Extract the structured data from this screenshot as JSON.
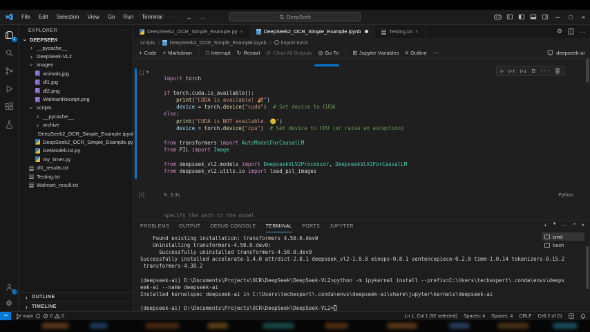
{
  "titlebar": {
    "menus": [
      "File",
      "Edit",
      "Selection",
      "View",
      "Go",
      "Run",
      "Terminal"
    ],
    "overflow": "···",
    "command_center": "DeepSeek",
    "icons": [
      "copilot-icon",
      "customize-layout-icon",
      "toggle-sidebar-icon",
      "toggle-panel-icon",
      "toggle-secondary-sidebar-icon",
      "minimize-icon",
      "maximize-icon",
      "close-icon"
    ]
  },
  "activitybar": {
    "icons": [
      "explorer-icon",
      "search-icon",
      "source-control-icon",
      "run-debug-icon",
      "extensions-icon",
      "testing-icon"
    ],
    "explorer_badge": "1",
    "account_badge": "1",
    "bottom_icons": [
      "account-icon",
      "settings-gear-icon"
    ]
  },
  "explorer": {
    "title": "EXPLORER",
    "root": "DEEPSEEK",
    "items": [
      {
        "label": "__pycache__",
        "type": "folder-collapsed",
        "level": 1
      },
      {
        "label": "DeepSeek-VL2",
        "type": "folder-collapsed",
        "level": 1
      },
      {
        "label": "images",
        "type": "folder-open",
        "level": 1
      },
      {
        "label": "animals.jpg",
        "type": "image",
        "level": 2
      },
      {
        "label": "dl1.jpg",
        "type": "image",
        "level": 2
      },
      {
        "label": "dl2.png",
        "type": "image",
        "level": 2
      },
      {
        "label": "WalmartReceipt.png",
        "type": "image",
        "level": 2
      },
      {
        "label": "scripts",
        "type": "folder-open",
        "level": 1
      },
      {
        "label": "__pycache__",
        "type": "folder-collapsed",
        "level": 2
      },
      {
        "label": "archive",
        "type": "folder-collapsed",
        "level": 2
      },
      {
        "label": "DeepSeek2_OCR_Simple_Example.ipynb",
        "type": "notebook",
        "level": 2
      },
      {
        "label": "DeepSeek2_OCR_Simple_Example.py",
        "type": "python",
        "level": 2
      },
      {
        "label": "GetModelList.py",
        "type": "python",
        "level": 2
      },
      {
        "label": "my_timer.py",
        "type": "python",
        "level": 2
      },
      {
        "label": "dl1_results.txt",
        "type": "text",
        "level": 1
      },
      {
        "label": "Testing.txt",
        "type": "text",
        "level": 1
      },
      {
        "label": "Walmart_result.txt",
        "type": "text",
        "level": 1
      }
    ],
    "sections": [
      "OUTLINE",
      "TIMELINE"
    ]
  },
  "editor": {
    "tabs": [
      {
        "label": "DeepSeek2_OCR_Simple_Example.py",
        "icon": "python",
        "active": false,
        "modified": false
      },
      {
        "label": "DeepSeek2_OCR_Simple_Example.ipynb",
        "icon": "notebook",
        "active": true,
        "modified": true
      },
      {
        "label": "Testing.txt",
        "icon": "text",
        "active": false,
        "modified": false
      }
    ],
    "breadcrumb": [
      {
        "label": "scripts"
      },
      {
        "label": "DeepSeek2_OCR_Simple_Example.ipynb",
        "icon": "notebook"
      },
      {
        "label": "import torch",
        "icon": "symbol"
      }
    ],
    "next_cell_preview": "specify the path to the model"
  },
  "notebook_toolbar": {
    "items": [
      {
        "icon": "add-icon",
        "label": "Code"
      },
      {
        "icon": "add-icon",
        "label": "Markdown"
      },
      {
        "sep": true
      },
      {
        "icon": "interrupt-icon",
        "label": "Interrupt"
      },
      {
        "icon": "restart-icon",
        "label": "Restart"
      },
      {
        "icon": "clear-outputs-icon",
        "label": "Clear All Outputs",
        "disabled": true
      },
      {
        "icon": "goto-icon",
        "label": "Go To"
      },
      {
        "sep": true
      },
      {
        "icon": "variables-icon",
        "label": "Jupyter Variables"
      },
      {
        "icon": "outline-icon",
        "label": "Outline"
      },
      {
        "icon": "more-icon",
        "label": "···"
      }
    ],
    "kernel": "deepseek-ai"
  },
  "cell": {
    "execution_count": "[1]",
    "duration": "5.3s",
    "language": "Python",
    "toolbar_icons": [
      "run-by-line-icon",
      "execute-above-icon",
      "execute-below-icon",
      "split-cell-icon",
      "more-actions-icon",
      "delete-cell-icon"
    ],
    "lines": [
      [
        [
          "kw",
          "import"
        ],
        [
          "tx",
          " torch"
        ]
      ],
      [],
      [
        [
          "kw",
          "if"
        ],
        [
          "tx",
          " torch.cuda.is_available():"
        ]
      ],
      [
        [
          "tx",
          "    "
        ],
        [
          "fn",
          "print"
        ],
        [
          "tx",
          "("
        ],
        [
          "st",
          "\"CUDA is available! 🎉\""
        ],
        [
          "tx",
          ")"
        ]
      ],
      [
        [
          "tx",
          "    "
        ],
        [
          "vr",
          "device"
        ],
        [
          "tx",
          " = torch."
        ],
        [
          "fn",
          "device"
        ],
        [
          "tx",
          "("
        ],
        [
          "st",
          "\"cuda\""
        ],
        [
          "tx",
          ")  "
        ],
        [
          "cm",
          "# Set device to CUDA"
        ]
      ],
      [
        [
          "kw",
          "else"
        ],
        [
          "tx",
          ":"
        ]
      ],
      [
        [
          "tx",
          "    "
        ],
        [
          "fn",
          "print"
        ],
        [
          "tx",
          "("
        ],
        [
          "st",
          "\"CUDA is NOT available. 😢\""
        ],
        [
          "tx",
          ")"
        ]
      ],
      [
        [
          "tx",
          "    "
        ],
        [
          "vr",
          "device"
        ],
        [
          "tx",
          " = torch."
        ],
        [
          "fn",
          "device"
        ],
        [
          "tx",
          "("
        ],
        [
          "st",
          "\"cpu\""
        ],
        [
          "tx",
          ")  "
        ],
        [
          "cm",
          "# Set device to CPU (or raise an exception)"
        ]
      ],
      [],
      [
        [
          "kw",
          "from"
        ],
        [
          "tx",
          " transformers "
        ],
        [
          "kw",
          "import"
        ],
        [
          "cl",
          " AutoModelForCausalLM"
        ]
      ],
      [
        [
          "kw",
          "from"
        ],
        [
          "tx",
          " PIL "
        ],
        [
          "kw",
          "import"
        ],
        [
          "cl",
          " Image"
        ]
      ],
      [],
      [
        [
          "kw",
          "from"
        ],
        [
          "tx",
          " deepseek_vl2.models "
        ],
        [
          "kw",
          "import"
        ],
        [
          "cl",
          " DeepseekVLV2Processor"
        ],
        [
          "tx",
          ","
        ],
        [
          "cl",
          " DeepseekVLV2ForCausalLM"
        ]
      ],
      [
        [
          "kw",
          "from"
        ],
        [
          "tx",
          " deepseek_vl2.utils.io "
        ],
        [
          "kw",
          "import"
        ],
        [
          "tx",
          " load_pil_images"
        ]
      ]
    ]
  },
  "panel": {
    "tabs": [
      "PROBLEMS",
      "OUTPUT",
      "DEBUG CONSOLE",
      "TERMINAL",
      "PORTS",
      "JUPYTER"
    ],
    "active_tab": "TERMINAL",
    "action_icons": [
      "new-terminal-icon",
      "terminal-dropdown-icon",
      "more-icon",
      "maximize-panel-icon",
      "close-panel-icon"
    ],
    "terminal_lines": [
      "    Found existing installation: transformers 4.50.0.dev0",
      "    Uninstalling transformers-4.50.0.dev0:",
      "      Successfully uninstalled transformers-4.50.0.dev0",
      "Successfully installed accelerate-1.4.0 attrdict-2.0.1 deepseek_vl2-1.0.0 einops-0.8.1 sentencepiece-0.2.0 timm-1.0.14 tokenizers-0.15.2",
      " transformers-4.38.2",
      "",
      "(deepseek-ai) D:\\Documents\\Projects\\OCR\\DeepSeek\\DeepSeek-VL2>python -m ipykernel install --prefix=C:\\Users\\techexpert\\.conda\\envs\\deeps",
      "eek-ai --name deepseek-ai",
      "Installed kernelspec deepseek-ai in C:\\Users\\techexpert\\.conda\\envs\\deepseek-ai\\share\\jupyter\\kernels\\deepseek-ai",
      "",
      "(deepseek-ai) D:\\Documents\\Projects\\OCR\\DeepSeek\\DeepSeek-VL2>"
    ],
    "terminals": [
      {
        "name": "cmd",
        "selected": true
      },
      {
        "name": "bash",
        "selected": false
      }
    ]
  },
  "statusbar": {
    "branch": "main",
    "errors": "0",
    "warnings": "0",
    "right_items": [
      "Ln 1, Col 1 (92 selected)",
      "Spaces: 4",
      "Spaces: 4",
      "CRLF",
      "Cell 2 of 21"
    ],
    "right_icons": [
      "layout-icon",
      "bell-icon"
    ]
  },
  "colors": {
    "accent_blue": "#0078d4",
    "editor_bg": "#1f1f1f",
    "chrome_bg": "#181818",
    "keyword": "#c586c0",
    "string": "#ce9178",
    "comment": "#6a9955",
    "class_name": "#4ec9b0",
    "function_name": "#dcdcaa",
    "variable": "#9cdcfe"
  }
}
